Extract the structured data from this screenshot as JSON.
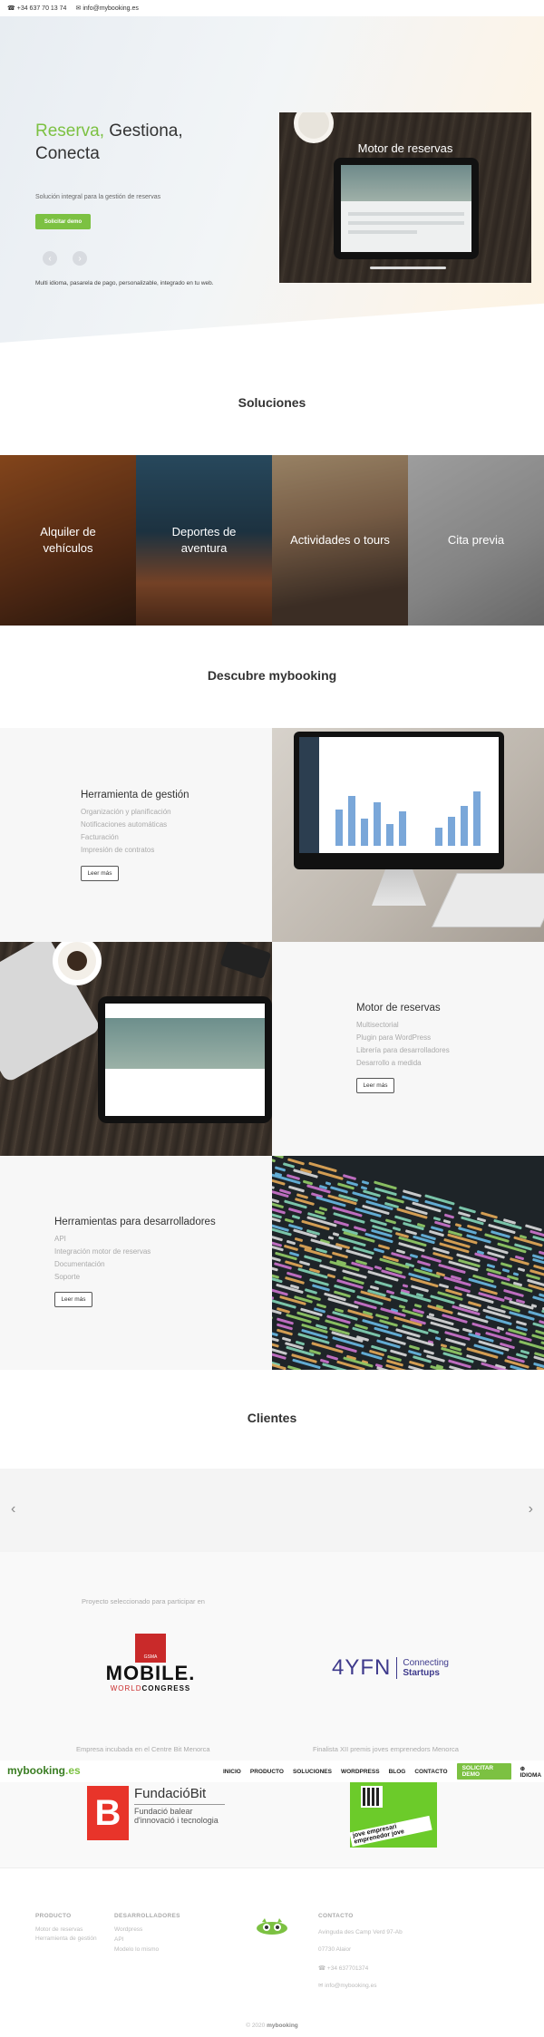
{
  "topbar": {
    "phone": "+34 637 70 13 74",
    "email": "info@mybooking.es",
    "phone_icon": "phone-icon",
    "email_icon": "envelope-icon"
  },
  "hero": {
    "title_accent": "Reserva,",
    "title_rest_1": " Gestiona,",
    "title_rest_2": "Conecta",
    "subtitle": "Solución integral para la gestión de reservas",
    "demo_button": "Solicitar demo",
    "prev_arrow": "‹",
    "next_arrow": "›",
    "description": "Multi idioma, pasarela de pago, personalizable, integrado en tu web.",
    "image_caption": "Motor de reservas"
  },
  "solutions": {
    "title": "Soluciones",
    "items": [
      {
        "label": "Alquiler de vehículos"
      },
      {
        "label": "Deportes de aventura"
      },
      {
        "label": "Actividades o tours"
      },
      {
        "label": "Cita previa"
      }
    ]
  },
  "discover": {
    "title": "Descubre mybooking",
    "blocks": [
      {
        "title": "Herramienta de gestión",
        "items": [
          "Organización y planificación",
          "Notificaciones automáticas",
          "Facturación",
          "Impresión de contratos"
        ],
        "button": "Leer más"
      },
      {
        "title": "Motor de reservas",
        "items": [
          "Multisectorial",
          "Plugin para WordPress",
          "Librería para desarrolladores",
          "Desarrollo a medida"
        ],
        "button": "Leer más"
      },
      {
        "title": "Herramientas para desarrolladores",
        "items": [
          "API",
          "Integración motor de reservas",
          "Documentación",
          "Soporte"
        ],
        "button": "Leer más"
      }
    ]
  },
  "clients": {
    "title": "Clientes",
    "prev": "‹",
    "next": "›"
  },
  "partners": {
    "selected_caption": "Proyecto seleccionado para participar en",
    "mwc_badge": "GSMA",
    "mwc_big": "MOBILE.",
    "mwc_small_1": "WORLD",
    "mwc_small_2": "CONGRESS",
    "yfn_mark": "4YFN",
    "yfn_line1": "Connecting",
    "yfn_line2": "Startups",
    "incubated_caption": "Empresa incubada en el Centre Bit Menorca",
    "finalist_caption": "Finalista XII premis joves emprenedors Menorca",
    "fbit_letter": "B",
    "fbit_name": "FundacióBit",
    "fbit_desc": "Fundació balear d'innovació i tecnologia",
    "jove_label": "jove empresari emprenedor jove"
  },
  "navbar": {
    "logo": "mybooking",
    "logo_tld": ".es",
    "links": [
      "INICIO",
      "PRODUCTO",
      "SOLUCIONES",
      "WORDPRESS",
      "BLOG",
      "CONTACTO"
    ],
    "demo": "SOLICITAR DEMO",
    "language": "IDIOMA",
    "language_icon": "globe-icon"
  },
  "footer": {
    "product": {
      "title": "PRODUCTO",
      "items": [
        "Motor de reservas",
        "Herramienta de gestión"
      ]
    },
    "developers": {
      "title": "DESARROLLADORES",
      "items": [
        "Wordpress",
        "API",
        "Modelo lo mismo"
      ]
    },
    "contact": {
      "title": "CONTACTO",
      "address_1": "Avinguda des Camp Verd 97-Ab",
      "address_2": "07730 Alaior",
      "phone": "+34 637701374",
      "email": "info@mybooking.es"
    },
    "copyright_prefix": "© 2020 ",
    "copyright_brand": "mybooking"
  },
  "colors": {
    "accent_green": "#7cc142",
    "brand_dark_green": "#3a7d22"
  }
}
